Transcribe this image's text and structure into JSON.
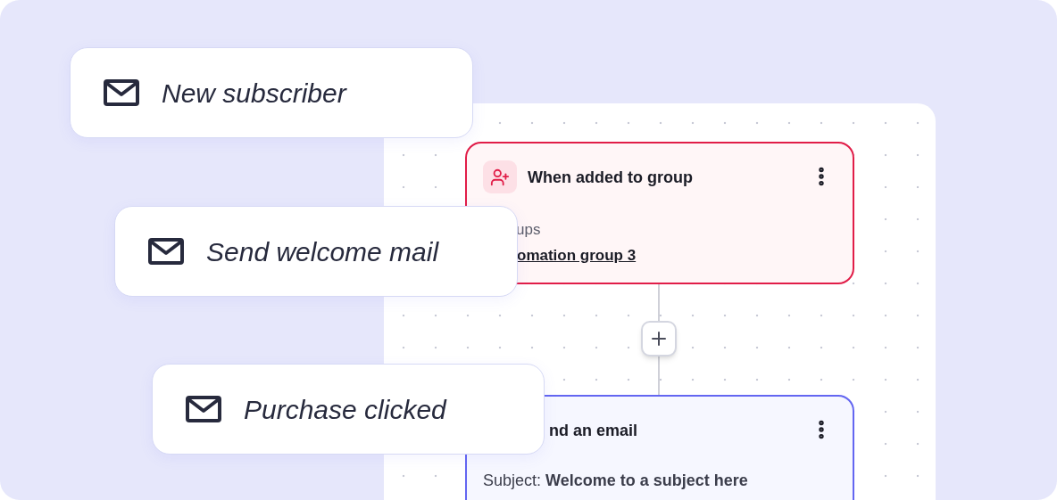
{
  "floating_cards": [
    {
      "label": "New subscriber"
    },
    {
      "label": "Send welcome mail"
    },
    {
      "label": "Purchase clicked"
    }
  ],
  "workflow": {
    "nodes": [
      {
        "kind": "trigger",
        "title": "When added to group",
        "field_label": "ups",
        "field_value": "omation group 3"
      },
      {
        "kind": "action",
        "title": "nd an email",
        "text": "Subject: **Welcome to a subject here**"
      }
    ]
  }
}
